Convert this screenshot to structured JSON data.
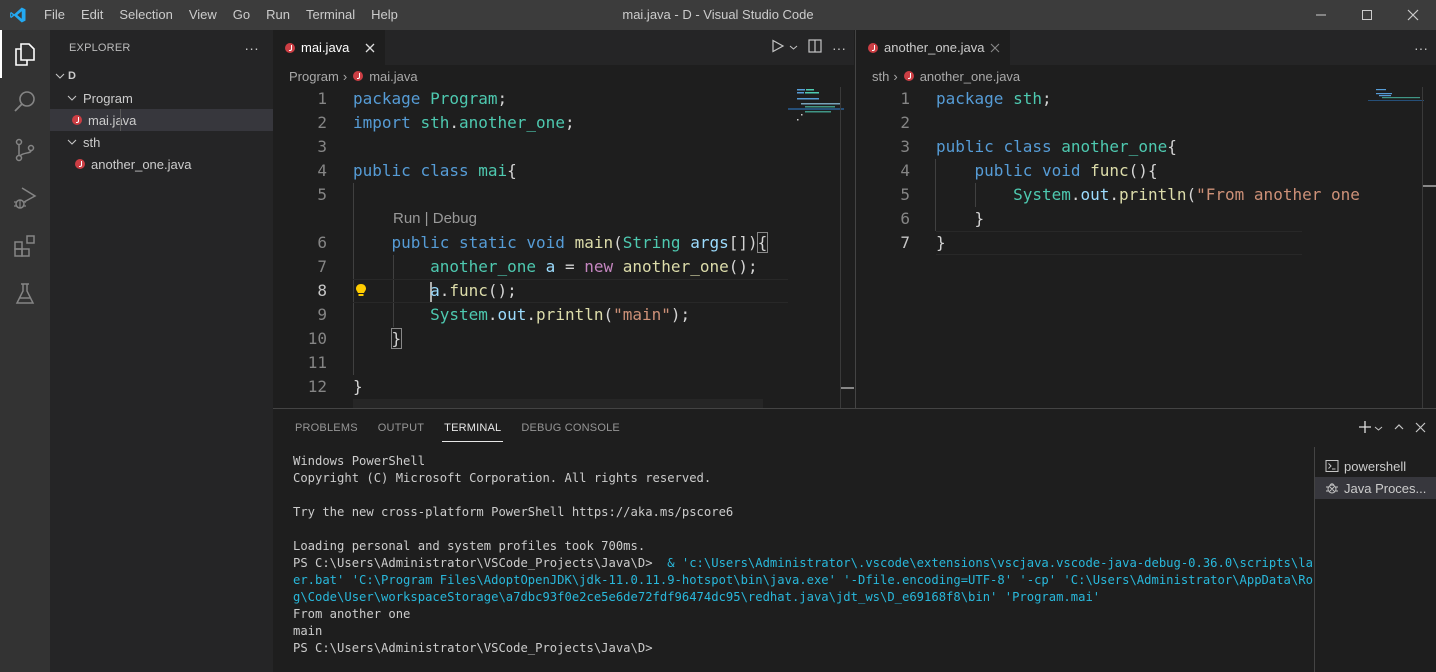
{
  "window": {
    "title": "mai.java - D - Visual Studio Code",
    "menu": [
      "File",
      "Edit",
      "Selection",
      "View",
      "Go",
      "Run",
      "Terminal",
      "Help"
    ]
  },
  "colors": {
    "accent": "#007acc",
    "java_icon": "#cc3e44",
    "terminal_cmd": "#29b8db"
  },
  "activity_bar": [
    {
      "name": "explorer",
      "icon": "files-icon"
    },
    {
      "name": "search",
      "icon": "search-icon"
    },
    {
      "name": "source-control",
      "icon": "source-control-icon"
    },
    {
      "name": "run-debug",
      "icon": "run-debug-icon"
    },
    {
      "name": "extensions",
      "icon": "extensions-icon"
    },
    {
      "name": "testing",
      "icon": "flask-icon"
    }
  ],
  "sidebar": {
    "title": "EXPLORER",
    "more": "···",
    "root": "D",
    "tree": [
      {
        "label": "Program",
        "type": "folder"
      },
      {
        "label": "mai.java",
        "type": "file",
        "selected": true
      },
      {
        "label": "sth",
        "type": "folder"
      },
      {
        "label": "another_one.java",
        "type": "file"
      }
    ]
  },
  "editor_left": {
    "tab": "mai.java",
    "breadcrumb": [
      "Program",
      "mai.java"
    ],
    "codelens": "Run | Debug",
    "lines": [
      "1",
      "2",
      "3",
      "4",
      "5",
      "6",
      "7",
      "8",
      "9",
      "10",
      "11",
      "12"
    ],
    "code": {
      "l1a": "package",
      "l1b": "Program",
      "l1c": ";",
      "l2a": "import",
      "l2b": "sth",
      "l2c": ".",
      "l2d": "another_one",
      "l2e": ";",
      "l4a": "public",
      "l4b": "class",
      "l4c": "mai",
      "l4d": "{",
      "l6a": "public",
      "l6b": "static",
      "l6c": "void",
      "l6d": "main",
      "l6e": "(",
      "l6f": "String",
      "l6g": "args",
      "l6h": "[])",
      "l6i": "{",
      "l7a": "another_one",
      "l7b": "a",
      "l7c": " = ",
      "l7d": "new",
      "l7e": "another_one",
      "l7f": "();",
      "l8a": "a",
      "l8b": ".",
      "l8c": "func",
      "l8d": "();",
      "l9a": "System",
      "l9b": ".",
      "l9c": "out",
      "l9d": ".",
      "l9e": "println",
      "l9f": "(",
      "l9g": "\"main\"",
      "l9h": ");",
      "l10": "}",
      "l12": "}"
    }
  },
  "editor_right": {
    "tab": "another_one.java",
    "breadcrumb": [
      "sth",
      "another_one.java"
    ],
    "lines": [
      "1",
      "2",
      "3",
      "4",
      "5",
      "6",
      "7"
    ],
    "code": {
      "l1a": "package",
      "l1b": "sth",
      "l1c": ";",
      "l3a": "public",
      "l3b": "class",
      "l3c": "another_one",
      "l3d": "{",
      "l4a": "public",
      "l4b": "void",
      "l4c": "func",
      "l4d": "(){",
      "l5a": "System",
      "l5b": ".",
      "l5c": "out",
      "l5d": ".",
      "l5e": "println",
      "l5f": "(",
      "l5g": "\"From another one",
      "l6": "}",
      "l7": "}"
    }
  },
  "panel": {
    "tabs": [
      "PROBLEMS",
      "OUTPUT",
      "TERMINAL",
      "DEBUG CONSOLE"
    ],
    "active_tab": "TERMINAL",
    "terminal_lines": [
      "Windows PowerShell",
      "Copyright (C) Microsoft Corporation. All rights reserved.",
      "",
      "Try the new cross-platform PowerShell https://aka.ms/pscore6",
      "",
      "Loading personal and system profiles took 700ms."
    ],
    "prompt": "PS C:\\Users\\Administrator\\VSCode_Projects\\Java\\D> ",
    "command_lines": [
      " & 'c:\\Users\\Administrator\\.vscode\\extensions\\vscjava.vscode-java-debug-0.36.0\\scripts\\launch",
      "er.bat' 'C:\\Program Files\\AdoptOpenJDK\\jdk-11.0.11.9-hotspot\\bin\\java.exe' '-Dfile.encoding=UTF-8' '-cp' 'C:\\Users\\Administrator\\AppData\\Roamin",
      "g\\Code\\User\\workspaceStorage\\a7dbc93f0e2ce5e6de72fdf96474dc95\\redhat.java\\jdt_ws\\D_e69168f8\\bin' 'Program.mai'"
    ],
    "output_lines": [
      "From another one",
      "main"
    ],
    "final_prompt": "PS C:\\Users\\Administrator\\VSCode_Projects\\Java\\D>",
    "terminals": [
      {
        "label": "powershell",
        "icon": "terminal-icon"
      },
      {
        "label": "Java Proces...",
        "icon": "debug-icon",
        "active": true
      }
    ]
  }
}
